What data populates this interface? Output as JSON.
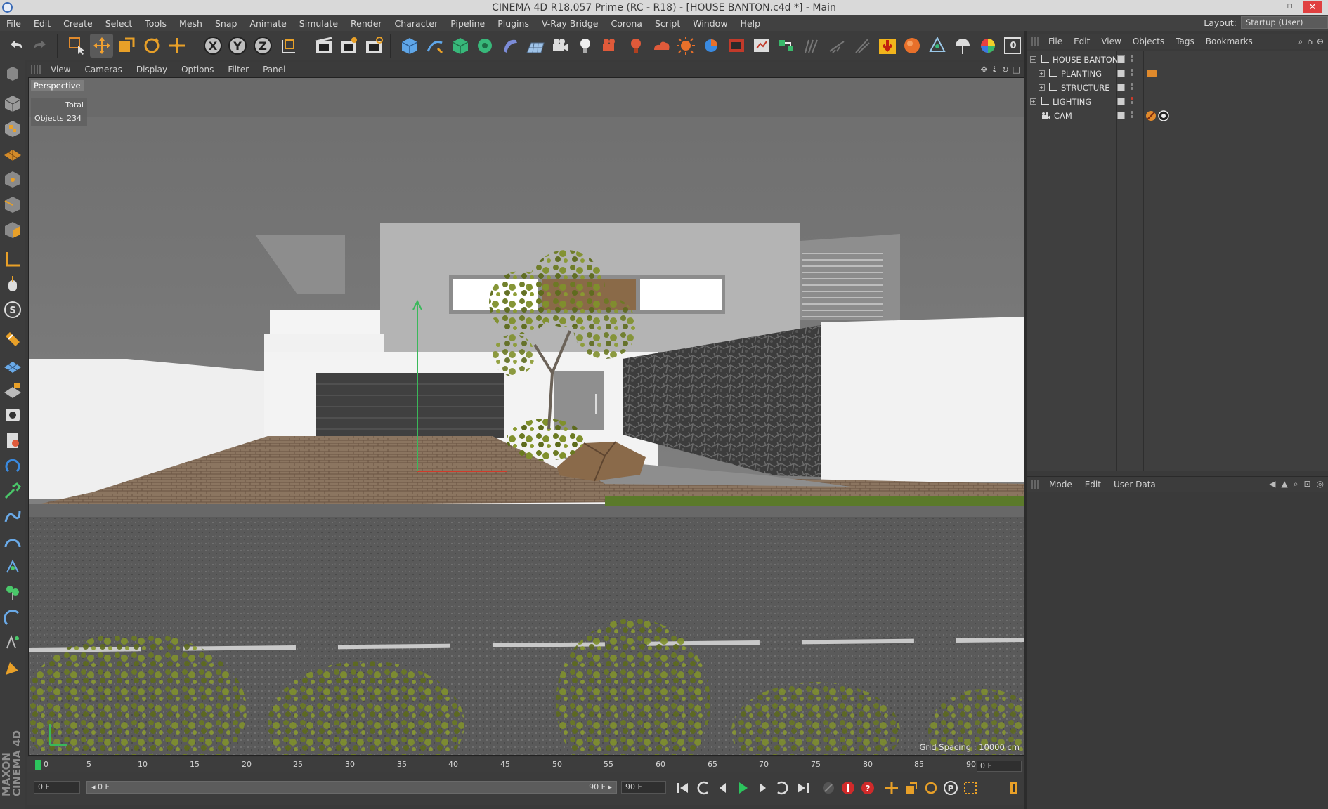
{
  "window": {
    "title": "CINEMA 4D R18.057 Prime (RC - R18) - [HOUSE BANTON.c4d *] - Main",
    "controls": [
      "–",
      "▫",
      "✕"
    ]
  },
  "menubar": {
    "items": [
      "File",
      "Edit",
      "Create",
      "Select",
      "Tools",
      "Mesh",
      "Snap",
      "Animate",
      "Simulate",
      "Render",
      "Character",
      "Pipeline",
      "Plugins",
      "V-Ray Bridge",
      "Corona",
      "Script",
      "Window",
      "Help"
    ],
    "layout_label": "Layout:",
    "layout_value": "Startup (User)"
  },
  "toolbar": {
    "axis_x": "X",
    "axis_y": "Y",
    "axis_z": "Z",
    "panel_badge": "0"
  },
  "viewport": {
    "menu": [
      "View",
      "Cameras",
      "Display",
      "Options",
      "Filter",
      "Panel"
    ],
    "camera_label": "Perspective",
    "hud_total_label": "Total",
    "hud_objects_label": "Objects",
    "hud_objects_count": "234",
    "grid_spacing": "Grid Spacing : 10000 cm"
  },
  "timeline": {
    "ticks": [
      "0",
      "5",
      "10",
      "15",
      "20",
      "25",
      "30",
      "35",
      "40",
      "45",
      "50",
      "55",
      "60",
      "65",
      "70",
      "75",
      "80",
      "85",
      "90"
    ],
    "current_frame": "0 F"
  },
  "playback": {
    "start_field": "0 F",
    "range_start": "◂ 0 F",
    "range_end": "90 F ▸",
    "end_field": "90 F"
  },
  "object_manager": {
    "menu": [
      "File",
      "Edit",
      "View",
      "Objects",
      "Tags",
      "Bookmarks"
    ],
    "objects": [
      {
        "name": "HOUSE BANTON",
        "depth": 0,
        "expander": "−"
      },
      {
        "name": "PLANTING",
        "depth": 1,
        "expander": "+"
      },
      {
        "name": "STRUCTURE",
        "depth": 1,
        "expander": "+"
      },
      {
        "name": "LIGHTING",
        "depth": 0,
        "expander": "+"
      },
      {
        "name": "CAM",
        "depth": 1,
        "expander": ""
      }
    ]
  },
  "attributes_manager": {
    "menu": [
      "Mode",
      "Edit",
      "User Data"
    ]
  },
  "branding": {
    "logo_text": "MAXON CINEMA 4D"
  },
  "colors": {
    "accent_orange": "#e08a2c",
    "playhead_green": "#2cc45d",
    "record_red": "#d02a2a"
  }
}
